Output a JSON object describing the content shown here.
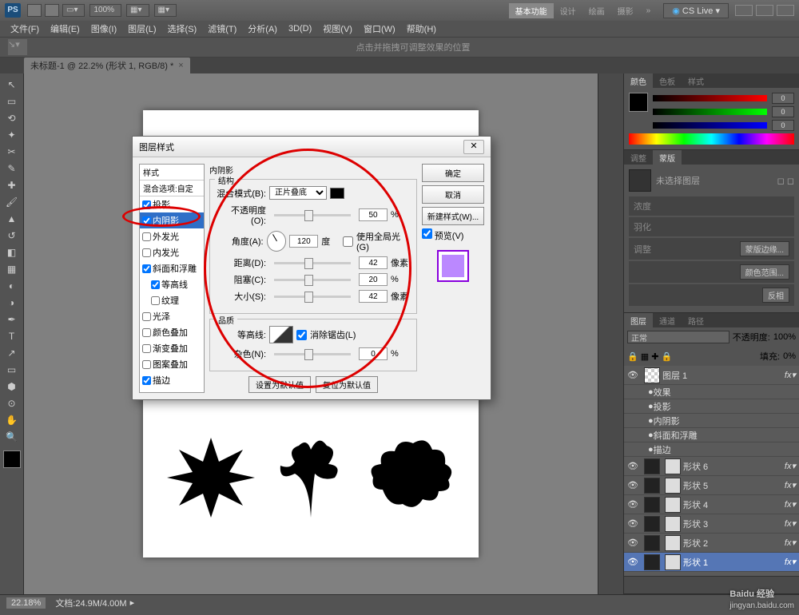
{
  "titlebar": {
    "zoom": "100%",
    "tabs": [
      "基本功能",
      "设计",
      "绘画",
      "摄影"
    ],
    "cslive": "CS Live"
  },
  "menu": [
    "文件(F)",
    "编辑(E)",
    "图像(I)",
    "图层(L)",
    "选择(S)",
    "滤镜(T)",
    "分析(A)",
    "3D(D)",
    "视图(V)",
    "窗口(W)",
    "帮助(H)"
  ],
  "optbar": {
    "hint": "点击并拖拽可调整效果的位置"
  },
  "doc_tab": {
    "label": "未标题-1 @ 22.2% (形状 1, RGB/8) *"
  },
  "panels": {
    "color": {
      "tabs": [
        "颜色",
        "色板",
        "样式"
      ],
      "r": "0",
      "g": "0",
      "b": "0"
    },
    "adjust": {
      "tabs": [
        "调整",
        "蒙版"
      ],
      "hint": "未选择图层",
      "rows": [
        "浓度",
        "羽化"
      ],
      "btns": [
        "调整",
        "蒙版边缘...",
        "颜色范围...",
        "反相"
      ]
    },
    "layers": {
      "tabs": [
        "图层",
        "通道",
        "路径"
      ],
      "blend": "正常",
      "opacity_lbl": "不透明度:",
      "opacity": "100%",
      "fill_lbl": "填充:",
      "fill": "0%",
      "top": "图层 1",
      "fx": "效果",
      "fx_items": [
        "投影",
        "内阴影",
        "斜面和浮雕",
        "描边"
      ],
      "shapes": [
        "形状 6",
        "形状 5",
        "形状 4",
        "形状 3",
        "形状 2",
        "形状 1"
      ]
    }
  },
  "status": {
    "zoom": "22.18%",
    "doc": "文档:24.9M/4.00M"
  },
  "dialog": {
    "title": "图层样式",
    "styles_h": [
      "样式",
      "混合选项:自定"
    ],
    "styles": [
      {
        "l": "投影",
        "c": true
      },
      {
        "l": "内阴影",
        "c": true,
        "sel": true
      },
      {
        "l": "外发光",
        "c": false
      },
      {
        "l": "内发光",
        "c": false
      },
      {
        "l": "斜面和浮雕",
        "c": true
      },
      {
        "l": "等高线",
        "c": true,
        "ind": true
      },
      {
        "l": "纹理",
        "c": false,
        "ind": true
      },
      {
        "l": "光泽",
        "c": false
      },
      {
        "l": "颜色叠加",
        "c": false
      },
      {
        "l": "渐变叠加",
        "c": false
      },
      {
        "l": "图案叠加",
        "c": false
      },
      {
        "l": "描边",
        "c": true
      }
    ],
    "section": "内阴影",
    "group1": "结构",
    "blend_lbl": "混合模式(B):",
    "blend": "正片叠底",
    "opacity_lbl": "不透明度(O):",
    "opacity": "50",
    "pct": "%",
    "angle_lbl": "角度(A):",
    "angle": "120",
    "deg": "度",
    "global": "使用全局光(G)",
    "dist_lbl": "距离(D):",
    "dist": "42",
    "px": "像素",
    "choke_lbl": "阻塞(C):",
    "choke": "20",
    "size_lbl": "大小(S):",
    "size": "42",
    "group2": "品质",
    "contour_lbl": "等高线:",
    "aa": "消除锯齿(L)",
    "noise_lbl": "杂色(N):",
    "noise": "0",
    "defaults": [
      "设置为默认值",
      "复位为默认值"
    ],
    "btns": {
      "ok": "确定",
      "cancel": "取消",
      "new": "新建样式(W)...",
      "preview": "预览(V)"
    }
  },
  "watermark": {
    "t1": "Baidu 经验",
    "t2": "jingyan.baidu.com"
  }
}
